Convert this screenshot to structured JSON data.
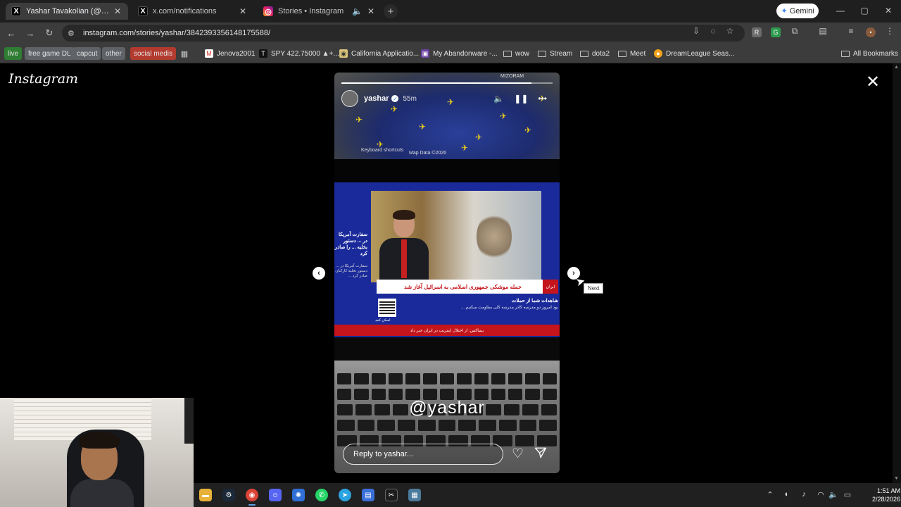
{
  "browser": {
    "tabs": [
      {
        "title": "Yashar Tavakolian (@yasharap",
        "icon": "x-logo-icon",
        "active": true
      },
      {
        "title": "x.com/notifications",
        "icon": "x-logo-icon",
        "active": false
      },
      {
        "title": "Stories • Instagram",
        "icon": "instagram-icon",
        "active": false
      }
    ],
    "new_tab": "+",
    "gemini_label": "Gemini",
    "url": "instagram.com/stories/yashar/3842393356148175588/",
    "bookmarks": [
      {
        "label": "live",
        "type": "tag",
        "color": "#2e7d32"
      },
      {
        "label": "free game DL",
        "type": "tag",
        "color": "#5f6368"
      },
      {
        "label": "capcut",
        "type": "tag",
        "color": "#5f6368"
      },
      {
        "label": "other",
        "type": "tag",
        "color": "#5f6368"
      },
      {
        "label": "social medis",
        "type": "tag",
        "color": "#b33a2e"
      },
      {
        "label": "Jenova2001",
        "type": "link"
      },
      {
        "label": "SPY 422.75000 ▲+...",
        "type": "link"
      },
      {
        "label": "California Applicatio...",
        "type": "link"
      },
      {
        "label": "My Abandonware -...",
        "type": "link"
      },
      {
        "label": "wow",
        "type": "folder"
      },
      {
        "label": "Stream",
        "type": "folder"
      },
      {
        "label": "dota2",
        "type": "folder"
      },
      {
        "label": "Meet",
        "type": "folder"
      },
      {
        "label": "DreamLeague Seas...",
        "type": "link"
      },
      {
        "label": "All Bookmarks",
        "type": "folder"
      }
    ]
  },
  "page": {
    "logo": "Instagram",
    "close_glyph": "✕",
    "story": {
      "username": "yashar",
      "time": "55m",
      "progress_fraction": 0.9,
      "map_labels": [
        "MIZORAM",
        "Keyboard shortcuts",
        "Map Data ©2026"
      ],
      "tv_sidebar_title": "سفارت آمریکا در ... دستور بخلیه ... را صادر کرد",
      "tv_sidebar_body": "سفارت آمریکا در ... دستور تخلیه کارکنان صادر کرد ...",
      "tv_headline": "حمله موشکی جمهوری اسلامی به اسرائیل آغاز شد",
      "tv_channel": "ایران",
      "tv_sub_title": "شاهدات شما از حملات",
      "tv_sub_body": "بود امروز دو مدرسه کادر مدرسه کلی مقاومت میکنیم ...",
      "tv_qr_label": "اسکن کنید",
      "tv_ticker": "ببنیاکس: از اختلال اینترنت در ایران خبر داد",
      "watermark": "@yashar",
      "reply_placeholder": "Reply to yashar..."
    },
    "next_tooltip": "Next"
  },
  "taskbar": {
    "time": "1:51 AM",
    "date": "2/28/2026"
  }
}
